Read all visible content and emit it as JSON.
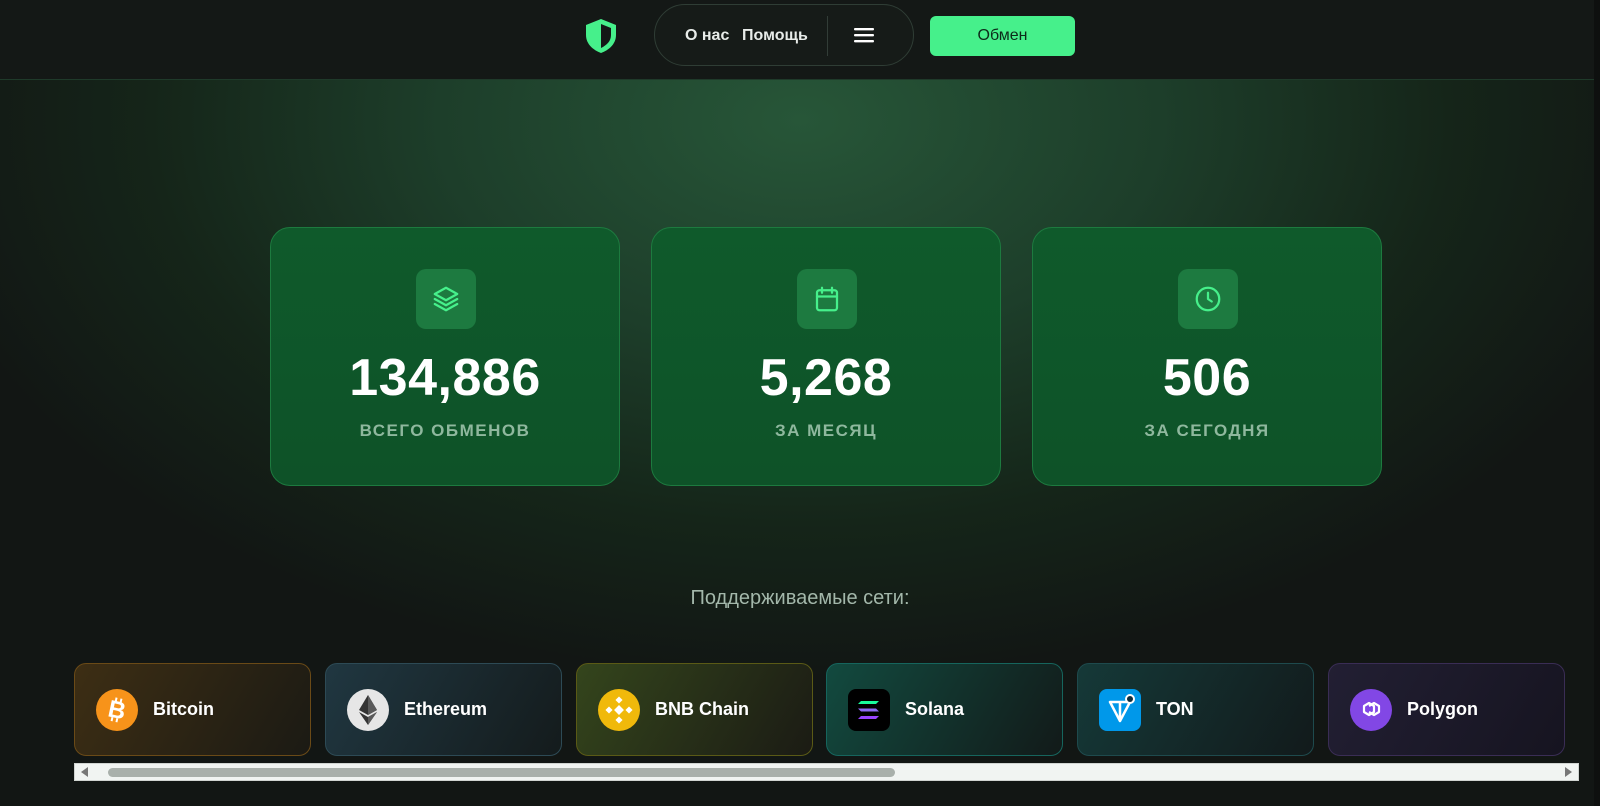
{
  "header": {
    "nav": {
      "about": "О нас",
      "help": "Помощь"
    },
    "exchange_button": "Обмен"
  },
  "stats": [
    {
      "icon": "layers-icon",
      "value": "134,886",
      "label": "ВСЕГО ОБМЕНОВ"
    },
    {
      "icon": "calendar-icon",
      "value": "5,268",
      "label": "ЗА МЕСЯЦ"
    },
    {
      "icon": "clock-icon",
      "value": "506",
      "label": "ЗА СЕГОДНЯ"
    }
  ],
  "networks": {
    "title": "Поддерживаемые сети:",
    "items": [
      {
        "name": "Bitcoin",
        "icon": "bitcoin-icon",
        "color": "#f7931a"
      },
      {
        "name": "Ethereum",
        "icon": "ethereum-icon",
        "color": "#e6e6e6"
      },
      {
        "name": "BNB Chain",
        "icon": "bnb-icon",
        "color": "#f0b90b"
      },
      {
        "name": "Solana",
        "icon": "solana-icon",
        "color": "#000000"
      },
      {
        "name": "TON",
        "icon": "ton-icon",
        "color": "#0098ea"
      },
      {
        "name": "Polygon",
        "icon": "polygon-icon",
        "color": "#8247e5"
      }
    ]
  },
  "colors": {
    "accent": "#46f08b",
    "card_bg": "#0f5a2b",
    "background": "#121614"
  }
}
